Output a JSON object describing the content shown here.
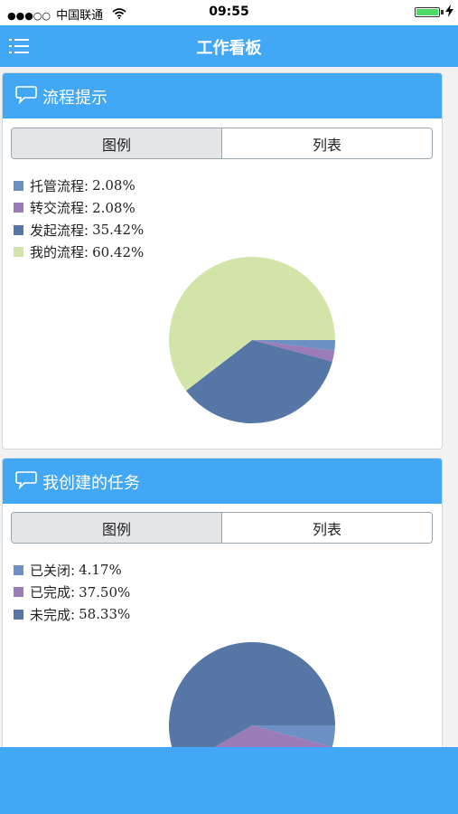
{
  "status_bar": {
    "signal": "●●●○○",
    "carrier": "中国联通",
    "time": "09:55"
  },
  "header": {
    "title": "工作看板"
  },
  "colors": {
    "brand": "#42a8f5",
    "slice_blue_light": "#6c8fc4",
    "slice_purple": "#9b7bb8",
    "slice_blue_dark": "#5676a5",
    "slice_green": "#d3e4a8"
  },
  "cards": [
    {
      "title": "流程提示",
      "tabs": [
        "图例",
        "列表"
      ],
      "active_tab": 0,
      "legend": [
        {
          "label": "托管流程:",
          "value": "2.08%",
          "color": "#6c8fc4"
        },
        {
          "label": "转交流程:",
          "value": "2.08%",
          "color": "#9b7bb8"
        },
        {
          "label": "发起流程:",
          "value": "35.42%",
          "color": "#5676a5"
        },
        {
          "label": "我的流程:",
          "value": "60.42%",
          "color": "#d3e4a8"
        }
      ]
    },
    {
      "title": "我创建的任务",
      "tabs": [
        "图例",
        "列表"
      ],
      "active_tab": 0,
      "legend": [
        {
          "label": "已关闭:",
          "value": "4.17%",
          "color": "#6c8fc4"
        },
        {
          "label": "已完成:",
          "value": "37.50%",
          "color": "#9b7bb8"
        },
        {
          "label": "未完成:",
          "value": "58.33%",
          "color": "#5676a5"
        }
      ]
    }
  ],
  "chart_data": [
    {
      "type": "pie",
      "categories": [
        "托管流程",
        "转交流程",
        "发起流程",
        "我的流程"
      ],
      "values": [
        2.08,
        2.08,
        35.42,
        60.42
      ],
      "colors": [
        "#6c8fc4",
        "#9b7bb8",
        "#5676a5",
        "#d3e4a8"
      ],
      "legend": "top-left"
    },
    {
      "type": "pie",
      "categories": [
        "已关闭",
        "已完成",
        "未完成"
      ],
      "values": [
        4.17,
        37.5,
        58.33
      ],
      "colors": [
        "#6c8fc4",
        "#9b7bb8",
        "#5676a5"
      ],
      "legend": "top-left"
    }
  ]
}
